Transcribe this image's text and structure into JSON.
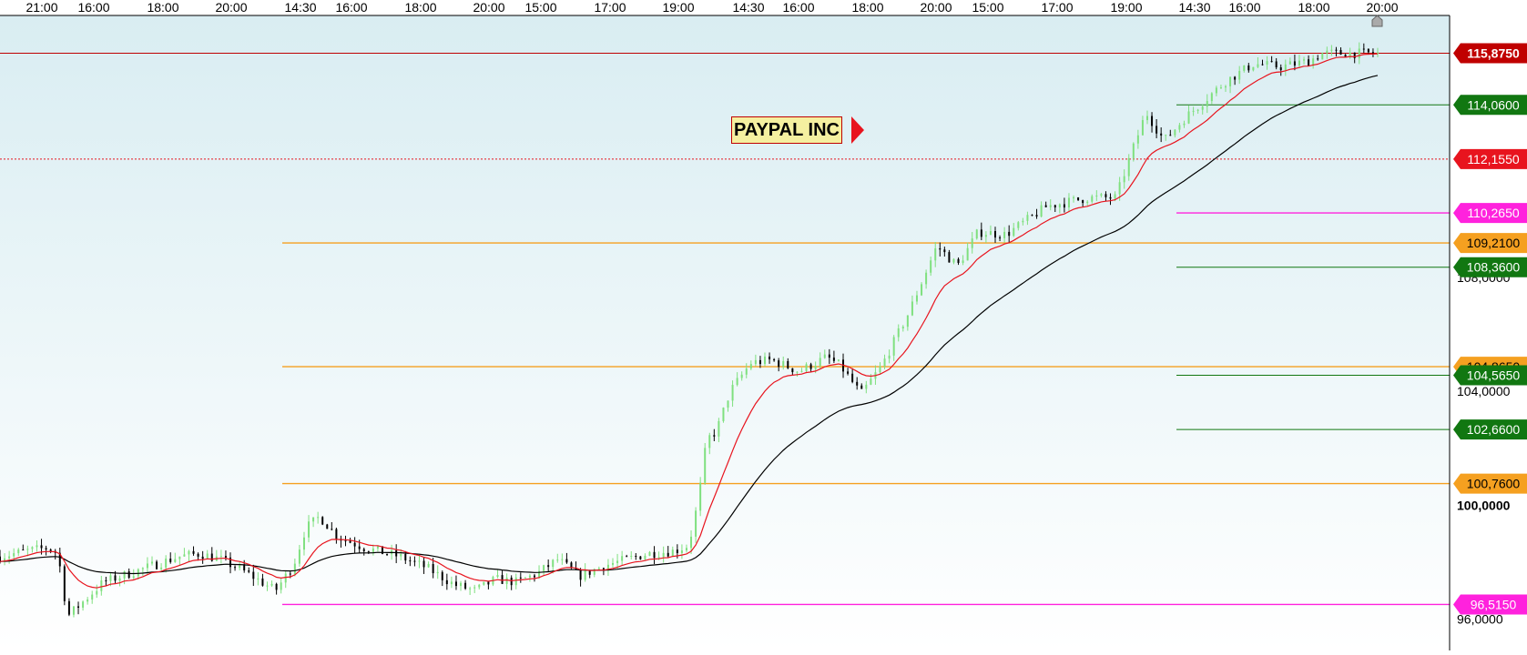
{
  "colors": {
    "background_top": "#d9edf2",
    "background_bottom": "#ffffff",
    "axis": "#000000",
    "candle_up": "#7fe07f",
    "candle_down": "#000000",
    "ema_fast": "#e8141e",
    "ema_slow": "#000000",
    "green_level": "#117711",
    "orange_level": "#f5a020",
    "magenta_level": "#ff22dd",
    "red_level": "#e8141e",
    "dark_red_label": "#c00000"
  },
  "chart_data": {
    "type": "candlestick",
    "title": "PAYPAL INC",
    "y_range": [
      94.9,
      117.2
    ],
    "y_axis_ticks": [
      "108,0000",
      "104,0000",
      "100,0000",
      "96,0000"
    ],
    "x_tick_labels": [
      "21:00",
      "16:00",
      "18:00",
      "20:00",
      "14:30",
      "16:00",
      "18:00",
      "20:00",
      "15:00",
      "17:00",
      "19:00",
      "14:30",
      "16:00",
      "18:00",
      "20:00",
      "15:00",
      "17:00",
      "19:00",
      "14:30",
      "16:00",
      "18:00",
      "20:00"
    ],
    "price_levels": [
      {
        "value": 115.875,
        "label": "115,8750",
        "kind": "last-price",
        "color": "#c00000",
        "from_session": 0
      },
      {
        "value": 114.06,
        "label": "114,0600",
        "kind": "support",
        "color": "#117711",
        "from_session": 4
      },
      {
        "value": 112.155,
        "label": "112,1550",
        "kind": "dotted",
        "color": "#e8141e",
        "from_session": 0
      },
      {
        "value": 110.265,
        "label": "110,2650",
        "kind": "marker",
        "color": "#ff22dd",
        "from_session": 4
      },
      {
        "value": 109.21,
        "label": "109,2100",
        "kind": "resistance",
        "color": "#f5a020",
        "from_session": 1
      },
      {
        "value": 108.36,
        "label": "108,3600",
        "kind": "support",
        "color": "#117711",
        "from_session": 4
      },
      {
        "value": 104.865,
        "label": "104,8650",
        "kind": "resistance",
        "color": "#f5a020",
        "from_session": 1
      },
      {
        "value": 104.565,
        "label": "104,5650",
        "kind": "support",
        "color": "#117711",
        "from_session": 4
      },
      {
        "value": 102.66,
        "label": "102,6600",
        "kind": "support",
        "color": "#117711",
        "from_session": 4
      },
      {
        "value": 100.76,
        "label": "100,7600",
        "kind": "resistance",
        "color": "#f5a020",
        "from_session": 1
      },
      {
        "value": 96.515,
        "label": "96,5150",
        "kind": "marker",
        "color": "#ff22dd",
        "from_session": 1
      }
    ],
    "price_path": [
      [
        0,
        98.2
      ],
      [
        0.02,
        98.4
      ],
      [
        0.035,
        98.5
      ],
      [
        0.042,
        98.3
      ],
      [
        0.049,
        96.1
      ],
      [
        0.06,
        96.6
      ],
      [
        0.075,
        97.3
      ],
      [
        0.1,
        97.7
      ],
      [
        0.13,
        98.2
      ],
      [
        0.145,
        98.3
      ],
      [
        0.16,
        98.1
      ],
      [
        0.18,
        97.6
      ],
      [
        0.2,
        97.0
      ],
      [
        0.213,
        97.9
      ],
      [
        0.222,
        99.2
      ],
      [
        0.232,
        99.6
      ],
      [
        0.245,
        98.9
      ],
      [
        0.265,
        98.5
      ],
      [
        0.29,
        98.2
      ],
      [
        0.31,
        97.8
      ],
      [
        0.33,
        97.2
      ],
      [
        0.345,
        97.0
      ],
      [
        0.36,
        97.4
      ],
      [
        0.375,
        97.3
      ],
      [
        0.39,
        97.6
      ],
      [
        0.405,
        98.1
      ],
      [
        0.42,
        97.5
      ],
      [
        0.44,
        97.9
      ],
      [
        0.47,
        98.3
      ],
      [
        0.49,
        98.4
      ],
      [
        0.5,
        98.6
      ],
      [
        0.507,
        100.2
      ],
      [
        0.513,
        102.3
      ],
      [
        0.52,
        102.6
      ],
      [
        0.53,
        104.0
      ],
      [
        0.545,
        105.0
      ],
      [
        0.56,
        105.1
      ],
      [
        0.58,
        104.7
      ],
      [
        0.6,
        105.2
      ],
      [
        0.61,
        104.9
      ],
      [
        0.625,
        103.9
      ],
      [
        0.64,
        104.9
      ],
      [
        0.66,
        106.8
      ],
      [
        0.673,
        108.3
      ],
      [
        0.68,
        109.1
      ],
      [
        0.695,
        108.4
      ],
      [
        0.71,
        109.6
      ],
      [
        0.73,
        109.5
      ],
      [
        0.76,
        110.5
      ],
      [
        0.79,
        110.8
      ],
      [
        0.81,
        110.8
      ],
      [
        0.82,
        112.2
      ],
      [
        0.832,
        113.8
      ],
      [
        0.845,
        112.8
      ],
      [
        0.86,
        113.6
      ],
      [
        0.89,
        114.9
      ],
      [
        0.91,
        115.5
      ],
      [
        0.93,
        115.4
      ],
      [
        0.95,
        115.6
      ],
      [
        0.96,
        115.87
      ]
    ]
  }
}
